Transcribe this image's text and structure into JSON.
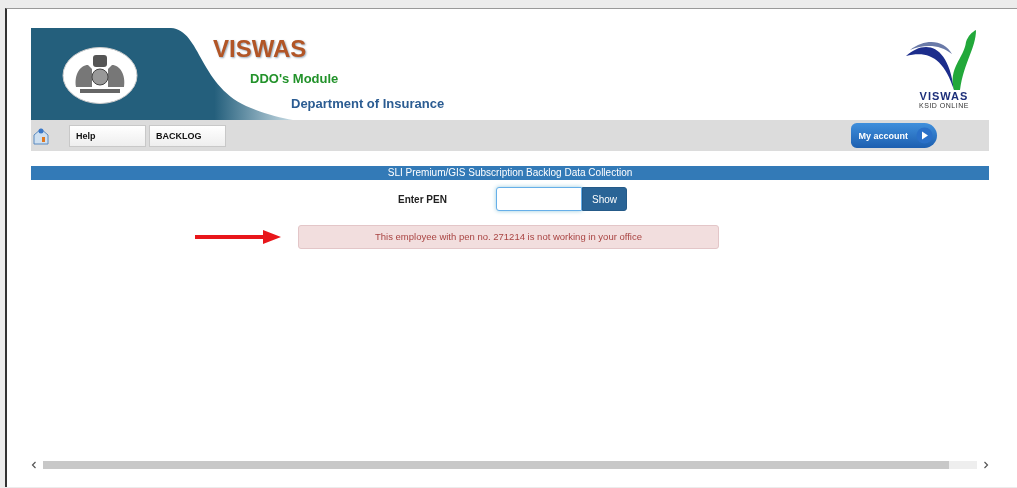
{
  "header": {
    "title": "VISWAS",
    "module": "DDO's Module",
    "department": "Department of Insurance",
    "logo_text": "VISWAS",
    "logo_subtext": "KSID ONLINE"
  },
  "nav": {
    "items": [
      {
        "label": "Help"
      },
      {
        "label": "BACKLOG"
      }
    ],
    "account_button": "My account"
  },
  "section_title": "SLI Premium/GIS Subscription Backlog Data Collection",
  "form": {
    "label": "Enter PEN",
    "button": "Show"
  },
  "alert": {
    "message": "This employee with pen no. 271214 is not working in your office"
  }
}
